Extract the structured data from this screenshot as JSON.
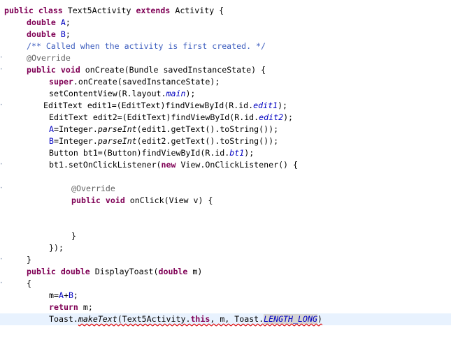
{
  "lines": [
    {
      "id": "l1",
      "indent": 6,
      "tokens": [
        [
          "kw",
          "public"
        ],
        [
          "",
          " "
        ],
        [
          "kw",
          "class"
        ],
        [
          "",
          " Text5Activity "
        ],
        [
          "kw",
          "extends"
        ],
        [
          "",
          " Activity {"
        ]
      ]
    },
    {
      "id": "l2",
      "indent": 38,
      "tokens": [
        [
          "kw",
          "double"
        ],
        [
          "",
          " "
        ],
        [
          "field",
          "A"
        ],
        [
          "",
          ";"
        ]
      ]
    },
    {
      "id": "l3",
      "indent": 38,
      "tokens": [
        [
          "kw",
          "double"
        ],
        [
          "",
          " "
        ],
        [
          "field",
          "B"
        ],
        [
          "",
          ";"
        ]
      ]
    },
    {
      "id": "l4",
      "indent": 38,
      "tokens": [
        [
          "jdoc",
          "/** Called when the activity is first created. */"
        ]
      ]
    },
    {
      "id": "l5",
      "indent": 38,
      "tokens": [
        [
          "anno",
          "@Override"
        ]
      ]
    },
    {
      "id": "l6",
      "indent": 38,
      "tokens": [
        [
          "kw",
          "public"
        ],
        [
          "",
          " "
        ],
        [
          "kw",
          "void"
        ],
        [
          "",
          " onCreate(Bundle savedInstanceState) {"
        ]
      ]
    },
    {
      "id": "l7",
      "indent": 70,
      "tokens": [
        [
          "kw",
          "super"
        ],
        [
          "",
          ".onCreate(savedInstanceState);"
        ]
      ]
    },
    {
      "id": "l8",
      "indent": 70,
      "tokens": [
        [
          "",
          "setContentView(R.layout."
        ],
        [
          "static-field",
          "main"
        ],
        [
          "",
          ");"
        ]
      ]
    },
    {
      "id": "l9",
      "indent": 62,
      "tokens": [
        [
          "",
          "EditText edit1=(EditText)findViewById(R.id."
        ],
        [
          "static-field",
          "edit1"
        ],
        [
          "",
          ");"
        ]
      ]
    },
    {
      "id": "l10",
      "indent": 70,
      "tokens": [
        [
          "",
          "EditText edit2=(EditText)findViewById(R.id."
        ],
        [
          "static-field",
          "edit2"
        ],
        [
          "",
          ");"
        ]
      ]
    },
    {
      "id": "l11",
      "indent": 70,
      "tokens": [
        [
          "field",
          "A"
        ],
        [
          "",
          "=Integer."
        ],
        [
          "static-method",
          "parseInt"
        ],
        [
          "",
          "(edit1.getText().toString());"
        ]
      ]
    },
    {
      "id": "l12",
      "indent": 70,
      "tokens": [
        [
          "field",
          "B"
        ],
        [
          "",
          "=Integer."
        ],
        [
          "static-method",
          "parseInt"
        ],
        [
          "",
          "(edit2.getText().toString());"
        ]
      ]
    },
    {
      "id": "l13",
      "indent": 70,
      "tokens": [
        [
          "",
          "Button bt1=(Button)findViewById(R.id."
        ],
        [
          "static-field",
          "bt1"
        ],
        [
          "",
          ");"
        ]
      ]
    },
    {
      "id": "l14",
      "indent": 70,
      "tokens": [
        [
          "",
          "bt1.setOnClickListener("
        ],
        [
          "kw",
          "new"
        ],
        [
          "",
          " View.OnClickListener() {"
        ]
      ]
    },
    {
      "id": "l15",
      "indent": 70,
      "tokens": []
    },
    {
      "id": "l16",
      "indent": 102,
      "tokens": [
        [
          "anno",
          "@Override"
        ]
      ]
    },
    {
      "id": "l17",
      "indent": 102,
      "tokens": [
        [
          "kw",
          "public"
        ],
        [
          "",
          " "
        ],
        [
          "kw",
          "void"
        ],
        [
          "",
          " onClick(View v) {"
        ]
      ]
    },
    {
      "id": "l18",
      "indent": 102,
      "tokens": []
    },
    {
      "id": "l19",
      "indent": 102,
      "tokens": []
    },
    {
      "id": "l20",
      "indent": 102,
      "tokens": [
        [
          "",
          "}"
        ]
      ]
    },
    {
      "id": "l21",
      "indent": 70,
      "tokens": [
        [
          "",
          "});"
        ]
      ]
    },
    {
      "id": "l22",
      "indent": 38,
      "tokens": [
        [
          "",
          "}"
        ]
      ]
    },
    {
      "id": "l23",
      "indent": 38,
      "tokens": [
        [
          "kw",
          "public"
        ],
        [
          "",
          " "
        ],
        [
          "kw",
          "double"
        ],
        [
          "",
          " DisplayToast("
        ],
        [
          "kw",
          "double"
        ],
        [
          "",
          " m)"
        ]
      ]
    },
    {
      "id": "l24",
      "indent": 38,
      "tokens": [
        [
          "",
          "{"
        ]
      ]
    },
    {
      "id": "l25",
      "indent": 70,
      "tokens": [
        [
          "",
          "m="
        ],
        [
          "field",
          "A"
        ],
        [
          "",
          "+"
        ],
        [
          "field",
          "B"
        ],
        [
          "",
          ";"
        ]
      ]
    },
    {
      "id": "l26",
      "indent": 70,
      "tokens": [
        [
          "kw",
          "return"
        ],
        [
          "",
          " m;"
        ]
      ]
    },
    {
      "id": "l27",
      "indent": 70,
      "current": true,
      "tokens": [
        [
          "",
          "Toast."
        ],
        [
          "static-method err",
          "makeText"
        ],
        [
          "err",
          "(Text5Activity."
        ],
        [
          "kw err",
          "this"
        ],
        [
          "err",
          ", m, Toast."
        ],
        [
          "static-field occ err",
          "LENGTH_LONG"
        ],
        [
          "err",
          ")"
        ]
      ]
    }
  ]
}
